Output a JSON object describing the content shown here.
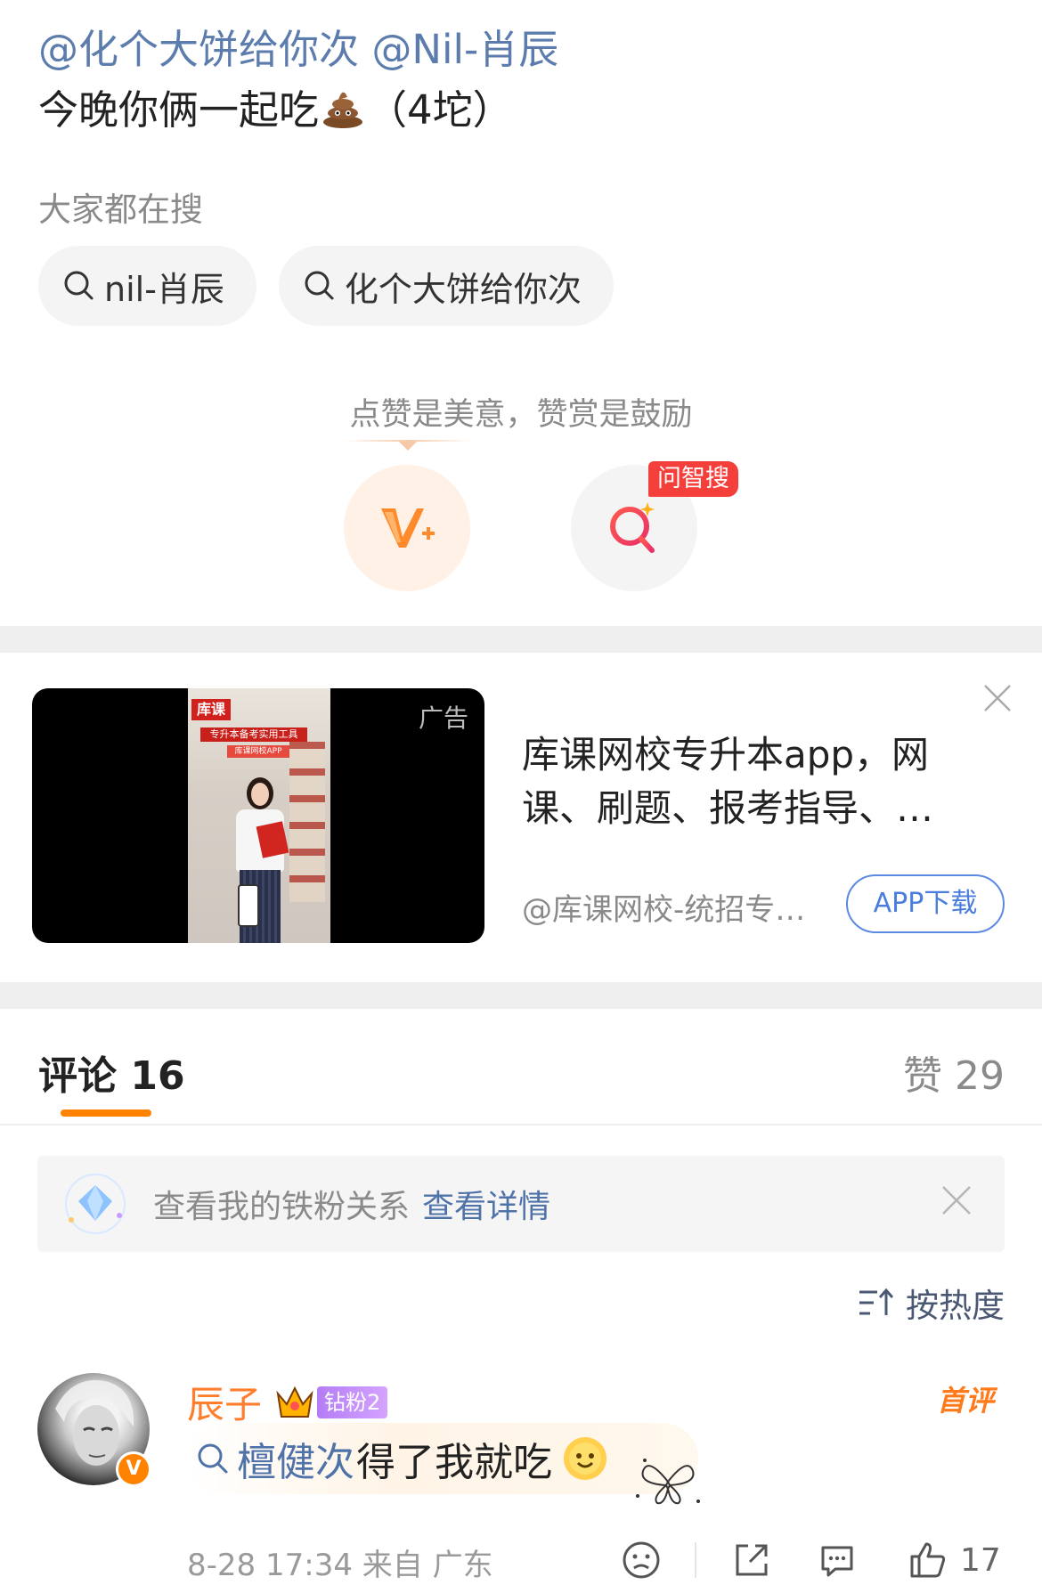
{
  "post": {
    "mention_1": "@化个大饼给你次",
    "mention_2": "@Nil-肖辰",
    "text_before": "今晚你俩一起吃",
    "text_after": "（4坨）",
    "emoji": "poop-emoji"
  },
  "trending": {
    "title": "大家都在搜",
    "chips": [
      "nil-肖辰",
      "化个大饼给你次"
    ]
  },
  "praise": {
    "hint": "点赞是美意，赞赏是鼓励",
    "zhisou_badge": "问智搜"
  },
  "ad": {
    "tag": "广告",
    "video_logo": "库课",
    "video_banner_1": "专升本备考实用工具",
    "video_banner_2": "库课网校APP",
    "title_line_1": "库课网校专升本app，网",
    "title_line_2": "课、刷题、报考指导、…",
    "source": "@库课网校-统招专…",
    "button": "APP下载"
  },
  "tabs": {
    "comments_label": "评论",
    "comments_count": "16",
    "likes_label": "赞",
    "likes_count": "29"
  },
  "fan_bar": {
    "text": "查看我的铁粉关系",
    "link": "查看详情"
  },
  "sort": {
    "label": "按热度"
  },
  "comment": {
    "username": "辰子",
    "fan_badge": "钻粉2",
    "first_label": "首评",
    "verified_badge": "V",
    "search_term": "檀健次",
    "text": "得了我就吃",
    "time": "8-28 17:34",
    "location": "来自 广东",
    "likes": "17"
  },
  "colors": {
    "mention": "#5b7cad",
    "accent_orange": "#ff8200",
    "link_blue": "#4f72a8",
    "badge_red": "#f43f3b"
  }
}
